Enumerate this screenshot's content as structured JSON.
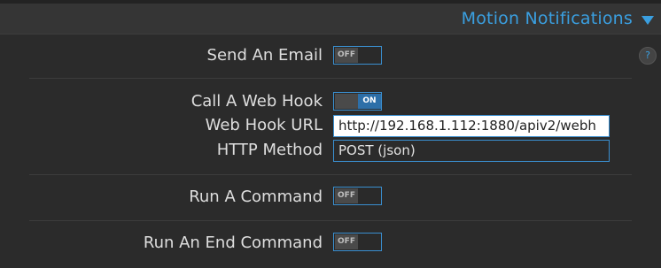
{
  "section": {
    "title": "Motion Notifications",
    "expanded_icon": "triangle-down-icon",
    "accent_color": "#3a9fe0"
  },
  "help": {
    "label": "?"
  },
  "rows": {
    "send_email": {
      "label": "Send An Email",
      "toggle": "OFF"
    },
    "web_hook": {
      "label": "Call A Web Hook",
      "toggle": "ON"
    },
    "web_hook_url": {
      "label": "Web Hook URL",
      "value": "http://192.168.1.112:1880/apiv2/webh"
    },
    "http_method": {
      "label": "HTTP Method",
      "value": "POST (json)"
    },
    "run_command": {
      "label": "Run A Command",
      "toggle": "OFF"
    },
    "run_end_command": {
      "label": "Run An End Command",
      "toggle": "OFF"
    }
  }
}
